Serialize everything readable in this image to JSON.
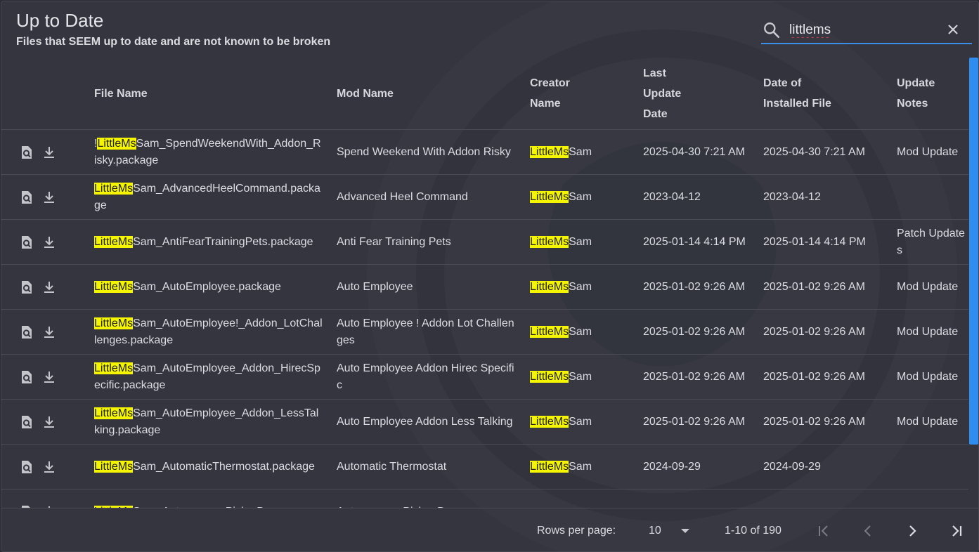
{
  "header": {
    "title": "Up to Date",
    "subtitle": "Files that SEEM up to date and are not known to be broken"
  },
  "search": {
    "value": "littlems",
    "icon": "search-icon",
    "clear_icon": "close-icon"
  },
  "columns": {
    "file_name": "File Name",
    "mod_name": "Mod Name",
    "creator_1": "Creator",
    "creator_2": "Name",
    "last_1": "Last",
    "last_2": "Update",
    "last_3": "Date",
    "inst_1": "Date of",
    "inst_2": "Installed File",
    "notes_1": "Update",
    "notes_2": "Notes"
  },
  "rows": [
    {
      "file_pre": "!",
      "file_hl": "LittleMs",
      "file_post": "Sam_SpendWeekendWith_Addon_Risky.package",
      "mod": "Spend Weekend With Addon Risky",
      "creator_hl": "LittleMs",
      "creator_post": "Sam",
      "last": "2025-04-30 7:21 AM",
      "installed": "2025-04-30 7:21 AM",
      "notes": "Mod Update"
    },
    {
      "file_pre": "",
      "file_hl": "LittleMs",
      "file_post": "Sam_AdvancedHeelCommand.package",
      "mod": "Advanced Heel Command",
      "creator_hl": "LittleMs",
      "creator_post": "Sam",
      "last": "2023-04-12",
      "installed": "2023-04-12",
      "notes": ""
    },
    {
      "file_pre": "",
      "file_hl": "LittleMs",
      "file_post": "Sam_AntiFearTrainingPets.package",
      "mod": "Anti Fear Training Pets",
      "creator_hl": "LittleMs",
      "creator_post": "Sam",
      "last": "2025-01-14 4:14 PM",
      "installed": "2025-01-14 4:14 PM",
      "notes": "Patch Updates"
    },
    {
      "file_pre": "",
      "file_hl": "LittleMs",
      "file_post": "Sam_AutoEmployee.package",
      "mod": "Auto Employee",
      "creator_hl": "LittleMs",
      "creator_post": "Sam",
      "last": "2025-01-02 9:26 AM",
      "installed": "2025-01-02 9:26 AM",
      "notes": "Mod Update"
    },
    {
      "file_pre": "",
      "file_hl": "LittleMs",
      "file_post": "Sam_AutoEmployee!_Addon_LotChallenges.package",
      "mod": "Auto Employee ! Addon Lot Challenges",
      "creator_hl": "LittleMs",
      "creator_post": "Sam",
      "last": "2025-01-02 9:26 AM",
      "installed": "2025-01-02 9:26 AM",
      "notes": "Mod Update"
    },
    {
      "file_pre": "",
      "file_hl": "LittleMs",
      "file_post": "Sam_AutoEmployee_Addon_HirecSpecific.package",
      "mod": "Auto Employee Addon Hirec Specific",
      "creator_hl": "LittleMs",
      "creator_post": "Sam",
      "last": "2025-01-02 9:26 AM",
      "installed": "2025-01-02 9:26 AM",
      "notes": "Mod Update"
    },
    {
      "file_pre": "",
      "file_hl": "LittleMs",
      "file_post": "Sam_AutoEmployee_Addon_LessTalking.package",
      "mod": "Auto Employee Addon Less Talking",
      "creator_hl": "LittleMs",
      "creator_post": "Sam",
      "last": "2025-01-02 9:26 AM",
      "installed": "2025-01-02 9:26 AM",
      "notes": "Mod Update"
    },
    {
      "file_pre": "",
      "file_hl": "LittleMs",
      "file_post": "Sam_AutomaticThermostat.package",
      "mod": "Automatic Thermostat",
      "creator_hl": "LittleMs",
      "creator_post": "Sam",
      "last": "2024-09-29",
      "installed": "2024-09-29",
      "notes": ""
    },
    {
      "file_pre": "",
      "file_hl": "LittleMs",
      "file_post": "Sam_AutonomousPickerDanc",
      "mod": "Autonomous Picker Dance",
      "creator_hl": "",
      "creator_post": "",
      "last": "",
      "installed": "",
      "notes": ""
    }
  ],
  "row_icons": [
    "view-details-icon",
    "download-icon"
  ],
  "footer": {
    "rows_per_page_label": "Rows per page:",
    "rows_per_page_value": "10",
    "range": "1-10 of 190",
    "icons": [
      "first-page-icon",
      "prev-page-icon",
      "next-page-icon",
      "last-page-icon"
    ]
  },
  "colors": {
    "background": "#34353f",
    "highlight": "#f5f500",
    "accent": "#2f8df0"
  }
}
